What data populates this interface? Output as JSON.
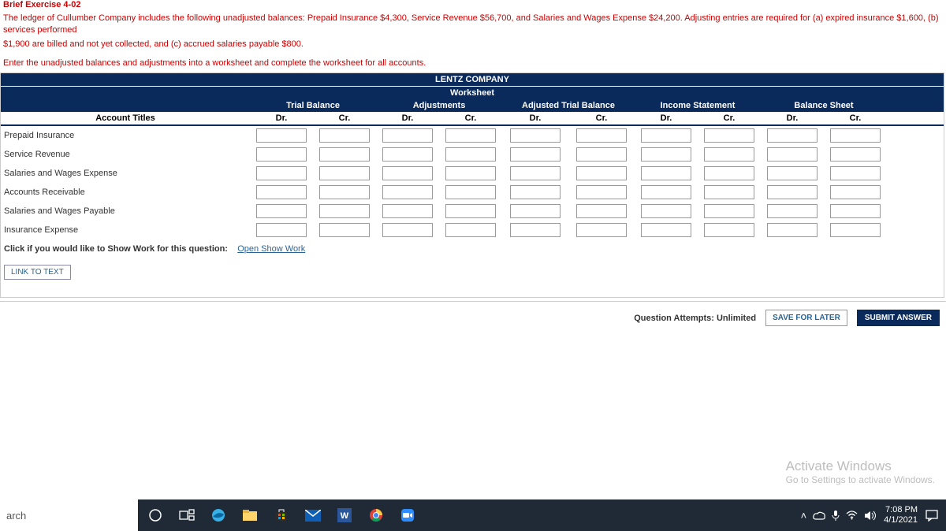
{
  "exercise": {
    "title": "Brief Exercise 4-02",
    "line1": "The ledger of Cullumber Company includes the following unadjusted balances: Prepaid Insurance $4,300, Service Revenue $56,700, and Salaries and Wages Expense $24,200. Adjusting entries are required for (a) expired insurance $1,600, (b) services performed",
    "line2": "$1,900 are billed and not yet collected, and (c) accrued salaries payable $800.",
    "subtask": "Enter the unadjusted balances and adjustments into a worksheet and complete the worksheet for all accounts."
  },
  "worksheet": {
    "company_line": "LENTZ COMPANY",
    "title_line": "Worksheet",
    "groups": [
      "Trial Balance",
      "Adjustments",
      "Adjusted Trial Balance",
      "Income Statement",
      "Balance Sheet"
    ],
    "account_titles_label": "Account Titles",
    "dr": "Dr.",
    "cr": "Cr.",
    "rows": [
      "Prepaid Insurance",
      "Service Revenue",
      "Salaries and Wages Expense",
      "Accounts Receivable",
      "Salaries and Wages Payable",
      "Insurance Expense"
    ]
  },
  "showwork": {
    "label": "Click if you would like to Show Work for this question:",
    "link": "Open Show Work"
  },
  "link_to_text": "LINK TO TEXT",
  "footer": {
    "attempts": "Question Attempts: Unlimited",
    "save": "SAVE FOR LATER",
    "submit": "SUBMIT ANSWER"
  },
  "watermark": {
    "heading": "Activate Windows",
    "sub": "Go to Settings to activate Windows."
  },
  "taskbar": {
    "search": "arch",
    "time": "7:08 PM",
    "date": "4/1/2021"
  }
}
